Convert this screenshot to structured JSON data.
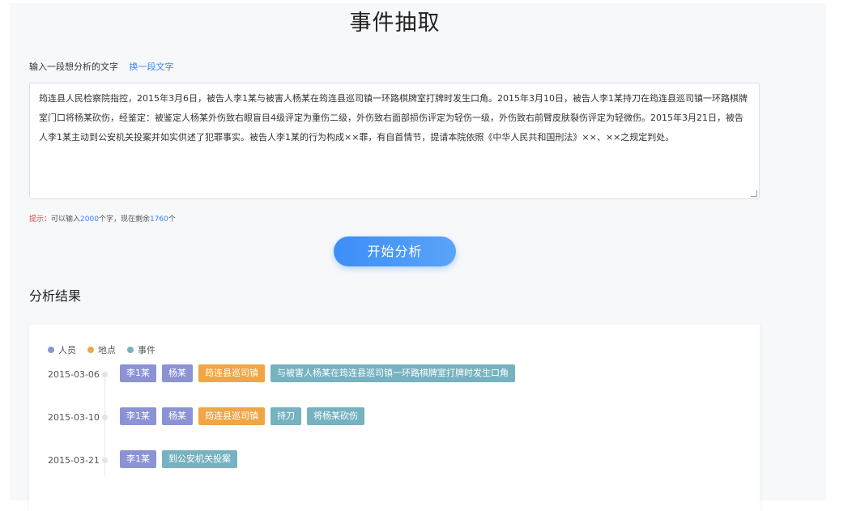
{
  "title": "事件抽取",
  "input": {
    "label": "输入一段想分析的文字",
    "change_link": "换一段文字",
    "text": "筠连县人民检察院指控，2015年3月6日，被告人李1某与被害人杨某在筠连县巡司镇一环路棋牌室打牌时发生口角。2015年3月10日，被告人李1某持刀在筠连县巡司镇一环路棋牌室门口将杨某砍伤，经鉴定：被鉴定人杨某外伤致右眼盲目4级评定为重伤二级，外伤致右面部损伤评定为轻伤一级，外伤致右前臂皮肤裂伤评定为轻微伤。2015年3月21日，被告人李1某主动到公安机关投案并如实供述了犯罪事实。被告人李1某的行为构成××罪，有自首情节，提请本院依照《中华人民共和国刑法》××、××之规定判处。"
  },
  "hint": {
    "label": "提示：",
    "prefix": "可以输入",
    "max": "2000",
    "middle": "个字，现在剩余",
    "remaining": "1760",
    "suffix": "个"
  },
  "start_button": "开始分析",
  "result": {
    "title": "分析结果",
    "legend": [
      {
        "label": "人员",
        "color": "#8c93d4"
      },
      {
        "label": "地点",
        "color": "#f0a645"
      },
      {
        "label": "事件",
        "color": "#76b2c0"
      }
    ],
    "timeline": [
      {
        "date": "2015-03-06",
        "tags": [
          {
            "text": "李1某",
            "type": "person"
          },
          {
            "text": "杨某",
            "type": "person"
          },
          {
            "text": "筠连县巡司镇",
            "type": "place"
          },
          {
            "text": "与被害人杨某在筠连县巡司镇一环路棋牌室打牌时发生口角",
            "type": "event"
          }
        ]
      },
      {
        "date": "2015-03-10",
        "tags": [
          {
            "text": "李1某",
            "type": "person"
          },
          {
            "text": "杨某",
            "type": "person"
          },
          {
            "text": "筠连县巡司镇",
            "type": "place"
          },
          {
            "text": "持刀",
            "type": "event"
          },
          {
            "text": "将杨某砍伤",
            "type": "event"
          }
        ]
      },
      {
        "date": "2015-03-21",
        "tags": [
          {
            "text": "李1某",
            "type": "person"
          },
          {
            "text": "到公安机关投案",
            "type": "event"
          }
        ]
      }
    ]
  }
}
